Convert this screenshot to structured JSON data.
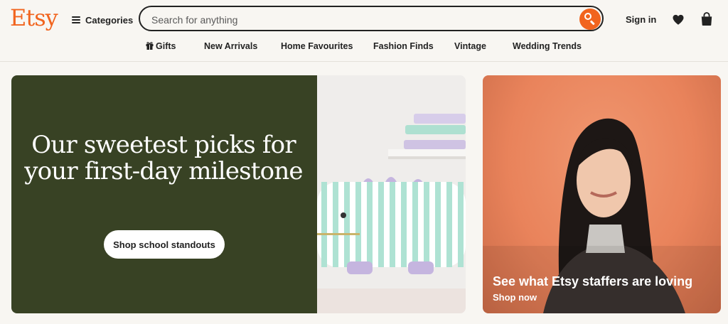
{
  "brand": {
    "logo_text": "Etsy",
    "accent": "#f1641e"
  },
  "header": {
    "categories_label": "Categories",
    "search": {
      "placeholder": "Search for anything",
      "value": ""
    },
    "sign_in_label": "Sign in",
    "icons": [
      "menu-icon",
      "search-icon",
      "heart-icon",
      "shopping-bag-icon",
      "gift-icon"
    ]
  },
  "nav": {
    "items": [
      "Gifts",
      "New Arrivals",
      "Home Favourites",
      "Fashion Finds",
      "Vintage",
      "Wedding Trends"
    ]
  },
  "hero": {
    "title": "Our sweetest picks for your first-day milestone",
    "cta_label": "Shop school standouts",
    "panel_color": "#384224"
  },
  "staff_card": {
    "title": "See what Etsy staffers are loving",
    "link_label": "Shop now",
    "bg_color": "#e9835b"
  }
}
